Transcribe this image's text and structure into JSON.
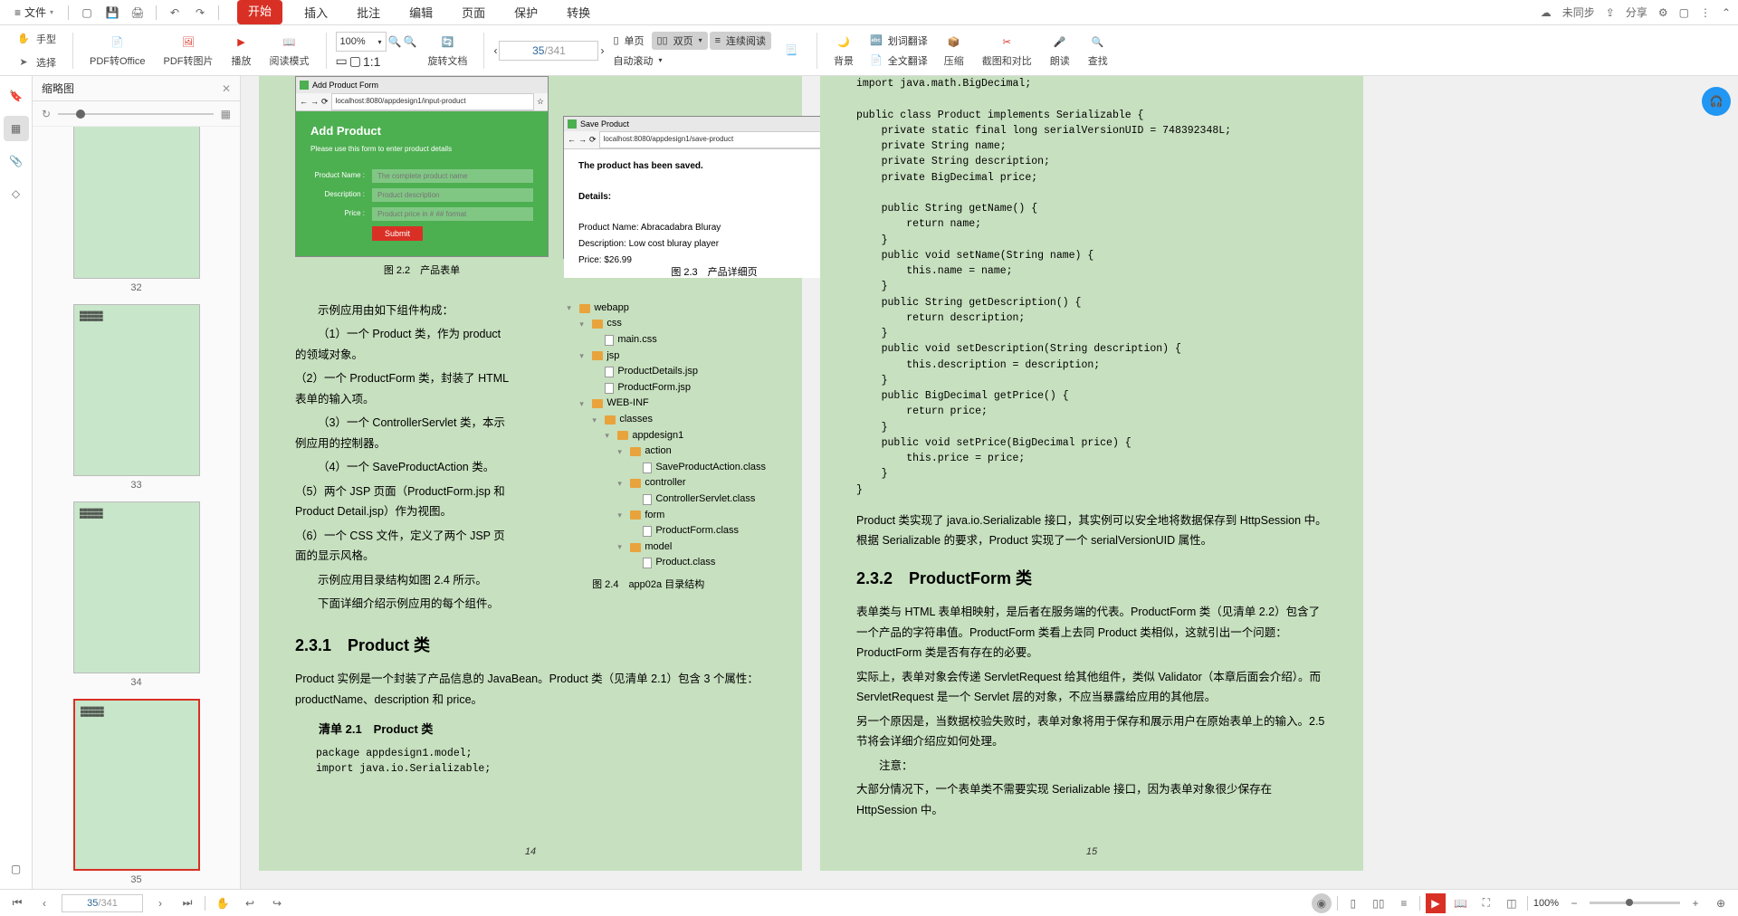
{
  "menubar": {
    "file": "文件",
    "tabs": [
      "开始",
      "插入",
      "批注",
      "编辑",
      "页面",
      "保护",
      "转换"
    ],
    "active_tab": 0,
    "right": {
      "sync": "未同步",
      "share": "分享"
    }
  },
  "toolbar": {
    "hand": "手型",
    "select": "选择",
    "pdf_to_office": "PDF转Office",
    "pdf_to_image": "PDF转图片",
    "play": "播放",
    "read_mode": "阅读模式",
    "zoom": "100%",
    "rotate": "旋转文档",
    "current_page": "35",
    "total_pages": "/341",
    "single_page": "单页",
    "double_page": "双页",
    "continuous": "连续阅读",
    "auto_scroll": "自动滚动",
    "background": "背景",
    "word_translate": "划词翻译",
    "full_translate": "全文翻译",
    "compress": "压缩",
    "screenshot_compare": "截图和对比",
    "read_aloud": "朗读",
    "search": "查找"
  },
  "thumbnail": {
    "title": "缩略图",
    "pages": [
      "32",
      "33",
      "34",
      "35"
    ]
  },
  "doc": {
    "fig22_caption": "图 2.2　产品表单",
    "fig23_caption": "图 2.3　产品详细页",
    "fig24_caption": "图 2.4　app02a 目录结构",
    "browser1": {
      "title": "Add Product Form",
      "url": "localhost:8080/appdesign1/input-product",
      "h": "Add Product",
      "sub": "Please use this form to enter product details",
      "lbl_name": "Product Name :",
      "ph_name": "The complete product name",
      "lbl_desc": "Description :",
      "ph_desc": "Product description",
      "lbl_price": "Price :",
      "ph_price": "Product price in # ## format",
      "submit": "Submit"
    },
    "browser2": {
      "title": "Save Product",
      "url": "localhost:8080/appdesign1/save-product",
      "saved": "The product has been saved.",
      "details": "Details:",
      "pn": "Product Name: Abracadabra Bluray",
      "pd": "Description: Low cost bluray player",
      "pp": "Price: $26.99"
    },
    "p_intro": "示例应用由如下组件构成：",
    "p1": "（1）一个 Product 类，作为 product 的领域对象。",
    "p2": "（2）一个 ProductForm 类，封装了 HTML 表单的输入项。",
    "p3": "（3）一个 ControllerServlet 类，本示例应用的控制器。",
    "p4": "（4）一个 SaveProductAction 类。",
    "p5": "（5）两个 JSP 页面（ProductForm.jsp 和 Product Detail.jsp）作为视图。",
    "p6": "（6）一个 CSS 文件，定义了两个 JSP 页面的显示风格。",
    "p7": "示例应用目录结构如图 2.4 所示。",
    "p8": "下面详细介绍示例应用的每个组件。",
    "s231": "2.3.1　Product 类",
    "p9": "Product 实例是一个封装了产品信息的 JavaBean。Product 类（见清单 2.1）包含 3 个属性：productName、description 和 price。",
    "listing21": "清单 2.1　Product 类",
    "code1": "package appdesign1.model;\nimport java.io.Serializable;",
    "code2": "import java.math.BigDecimal;\n\npublic class Product implements Serializable {\n    private static final long serialVersionUID = 748392348L;\n    private String name;\n    private String description;\n    private BigDecimal price;\n\n    public String getName() {\n        return name;\n    }\n    public void setName(String name) {\n        this.name = name;\n    }\n    public String getDescription() {\n        return description;\n    }\n    public void setDescription(String description) {\n        this.description = description;\n    }\n    public BigDecimal getPrice() {\n        return price;\n    }\n    public void setPrice(BigDecimal price) {\n        this.price = price;\n    }\n}",
    "p10": "Product 类实现了 java.io.Serializable 接口，其实例可以安全地将数据保存到 HttpSession 中。根据 Serializable 的要求，Product 实现了一个 serialVersionUID 属性。",
    "s232": "2.3.2　ProductForm 类",
    "p11": "表单类与 HTML 表单相映射，是后者在服务端的代表。ProductForm 类（见清单  2.2）包含了一个产品的字符串值。ProductForm  类看上去同  Product  类相似，这就引出一个问题：ProductForm 类是否有存在的必要。",
    "p12": "实际上，表单对象会传递 ServletRequest 给其他组件，类似 Validator（本章后面会介绍）。而 ServletRequest 是一个 Servlet 层的对象，不应当暴露给应用的其他层。",
    "p13": "另一个原因是，当数据校验失败时，表单对象将用于保存和展示用户在原始表单上的输入。2.5 节将会详细介绍应如何处理。",
    "note_label": "注意：",
    "note_body": "大部分情况下，一个表单类不需要实现  Serializable  接口，因为表单对象很少保存在 HttpSession 中。",
    "left_pagenum": "14",
    "right_pagenum": "15",
    "tree": {
      "webapp": "webapp",
      "css": "css",
      "maincss": "main.css",
      "jsp": "jsp",
      "productdetails": "ProductDetails.jsp",
      "productform": "ProductForm.jsp",
      "webinf": "WEB-INF",
      "classes": "classes",
      "appdesign1": "appdesign1",
      "action": "action",
      "saveproductaction": "SaveProductAction.class",
      "controller": "controller",
      "controllerservlet": "ControllerServlet.class",
      "form": "form",
      "productformclass": "ProductForm.class",
      "model": "model",
      "productclass": "Product.class"
    }
  },
  "statusbar": {
    "page_current": "35",
    "page_total": "/341",
    "zoom": "100%"
  }
}
